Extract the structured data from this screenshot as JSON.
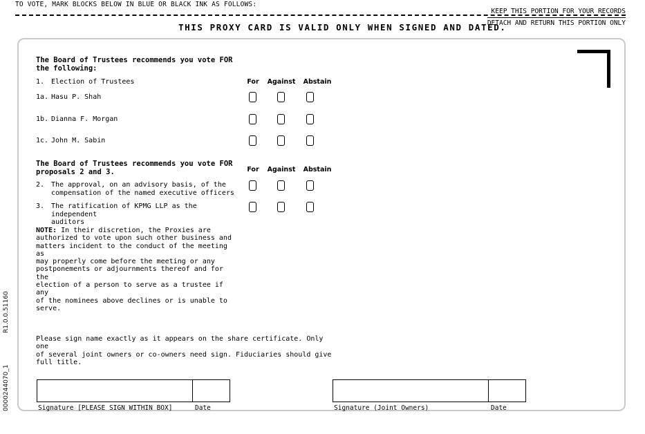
{
  "header": {
    "instruction": "TO VOTE, MARK BLOCKS BELOW IN BLUE OR BLACK INK AS FOLLOWS:",
    "validity_notice": "THIS PROXY CARD IS VALID ONLY WHEN SIGNED AND DATED.",
    "keep_portion": "KEEP THIS PORTION FOR YOUR RECORDS",
    "detach_portion": "DETACH AND RETURN THIS PORTION ONLY"
  },
  "margin_codes": {
    "revision": "R1.0.0.51160",
    "job_number": "0000244070_1"
  },
  "vote_columns": {
    "for": "For",
    "against": "Against",
    "abstain": "Abstain"
  },
  "sections": [
    {
      "recommendation": "The Board of Trustees recommends you vote FOR\nthe following:",
      "items": [
        {
          "number": "1.",
          "text": "Election of Trustees",
          "has_boxes": false
        },
        {
          "number": "1a.",
          "text": "Hasu P. Shah",
          "has_boxes": true
        },
        {
          "number": "1b.",
          "text": "Dianna F. Morgan",
          "has_boxes": true
        },
        {
          "number": "1c.",
          "text": "John M. Sabin",
          "has_boxes": true
        }
      ]
    },
    {
      "recommendation": "The Board of Trustees recommends you vote FOR\nproposals 2 and 3.",
      "items": [
        {
          "number": "2.",
          "text": "The approval, on an advisory basis, of the\ncompensation of the named executive officers",
          "has_boxes": true
        },
        {
          "number": "3.",
          "text": "The ratification of KPMG LLP as the independent\nauditors",
          "has_boxes": true
        }
      ]
    }
  ],
  "note": {
    "label": "NOTE:",
    "body": " In their discretion, the Proxies are\nauthorized to vote upon such other business and\nmatters incident to the conduct of the meeting as\nmay properly come before the meeting or any\npostponements or adjournments thereof and for the\nelection of a person to serve as a trustee if any\nof the nominees above declines or is unable to\nserve."
  },
  "signature_instructions": "Please sign name exactly as it appears on the share certificate.  Only one\nof several joint owners or co-owners need sign.  Fiduciaries should give\nfull title.",
  "signature_blocks": [
    {
      "signature_caption": "Signature [PLEASE SIGN WITHIN BOX]",
      "date_caption": "Date",
      "signature_value": "",
      "date_value": ""
    },
    {
      "signature_caption": "Signature (Joint Owners)",
      "date_caption": "Date",
      "signature_value": "",
      "date_value": ""
    }
  ]
}
